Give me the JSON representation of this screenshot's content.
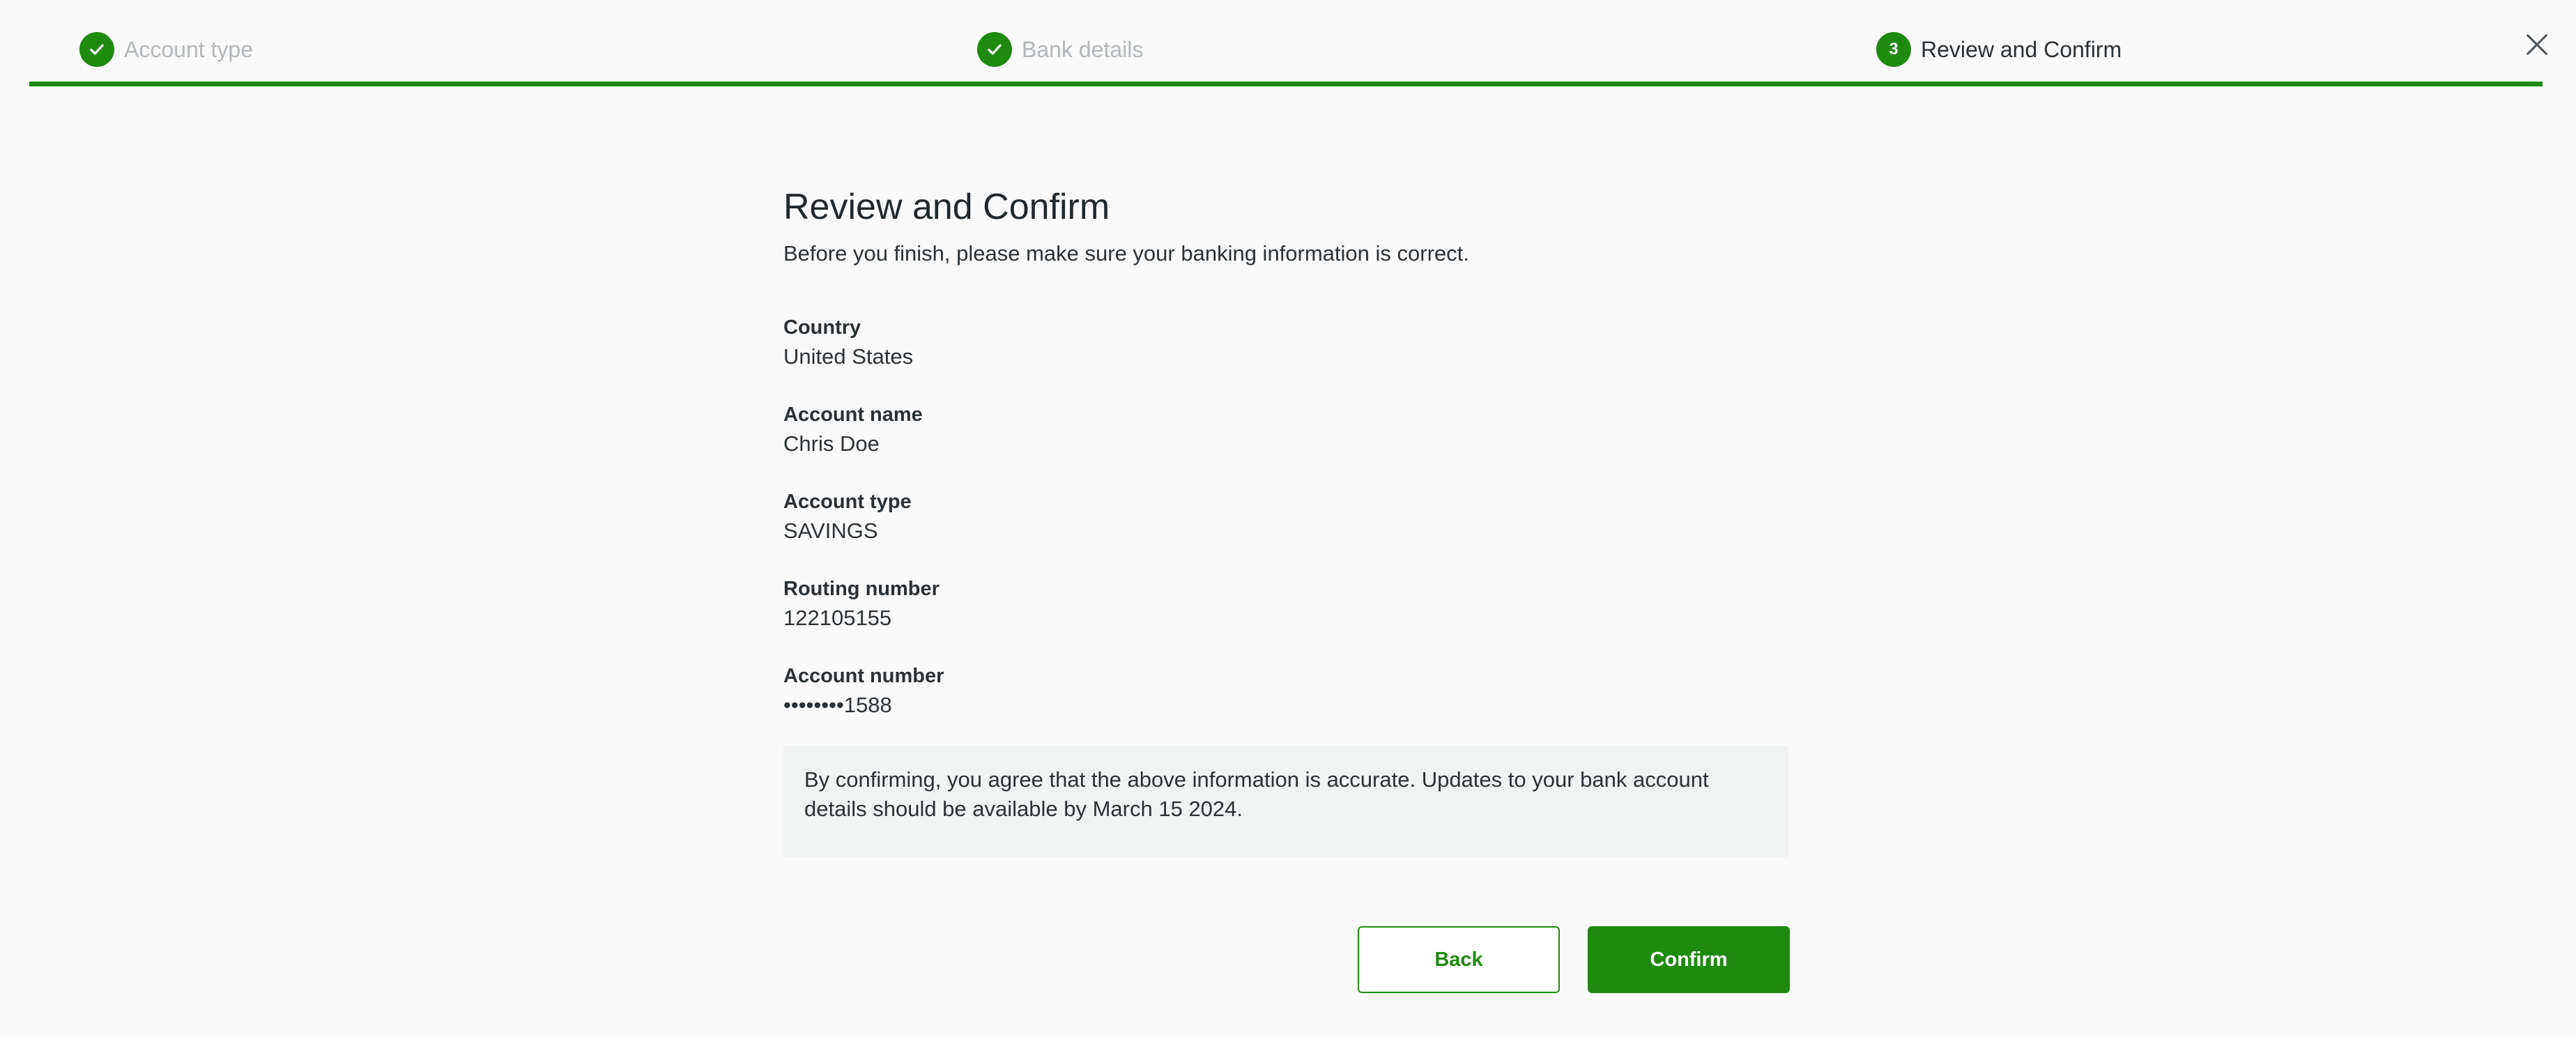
{
  "stepper": {
    "steps": [
      {
        "label": "Account type",
        "status": "complete",
        "icon": "check-icon"
      },
      {
        "label": "Bank details",
        "status": "complete",
        "icon": "check-icon"
      },
      {
        "label": "Review and Confirm",
        "status": "current",
        "number": "3"
      }
    ],
    "progress": 1.0
  },
  "close": {
    "icon": "close-icon"
  },
  "page": {
    "title": "Review and Confirm",
    "subtitle": "Before you finish, please make sure your banking information is correct."
  },
  "fields": [
    {
      "label": "Country",
      "value": "United States"
    },
    {
      "label": "Account name",
      "value": "Chris Doe"
    },
    {
      "label": "Account type",
      "value": "SAVINGS"
    },
    {
      "label": "Routing number",
      "value": "122105155"
    },
    {
      "label": "Account number",
      "value": "••••••••1588"
    }
  ],
  "notice": {
    "text": "By confirming, you agree that the above information is accurate. Updates to your bank account details should be available by March 15 2024."
  },
  "actions": {
    "back_label": "Back",
    "confirm_label": "Confirm"
  },
  "colors": {
    "accent": "#1e8a0e",
    "background": "#fafafa",
    "notice_bg": "#f1f3f3",
    "muted_text": "#b3b8bb"
  }
}
